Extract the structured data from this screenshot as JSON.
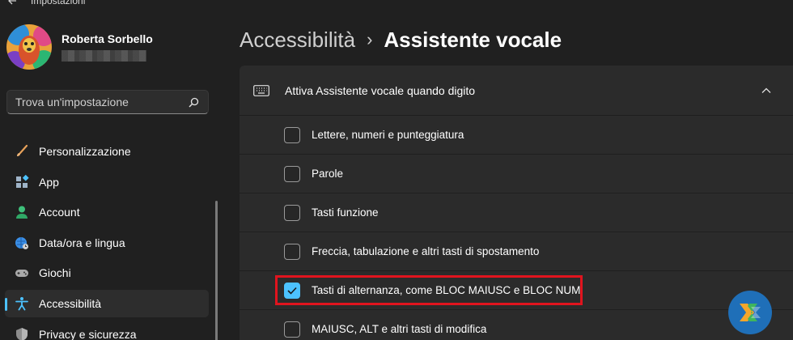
{
  "app": {
    "title": "Impostazioni"
  },
  "profile": {
    "name": "Roberta Sorbello"
  },
  "search": {
    "placeholder": "Trova un'impostazione"
  },
  "sidebar": {
    "items": [
      {
        "label": "Personalizzazione",
        "icon": "brush-icon",
        "selected": false
      },
      {
        "label": "App",
        "icon": "apps-icon",
        "selected": false
      },
      {
        "label": "Account",
        "icon": "account-icon",
        "selected": false
      },
      {
        "label": "Data/ora e lingua",
        "icon": "globe-clock-icon",
        "selected": false
      },
      {
        "label": "Giochi",
        "icon": "gamepad-icon",
        "selected": false
      },
      {
        "label": "Accessibilità",
        "icon": "accessibility-icon",
        "selected": true
      },
      {
        "label": "Privacy e sicurezza",
        "icon": "shield-icon",
        "selected": false
      }
    ]
  },
  "breadcrumb": {
    "parent": "Accessibilità",
    "separator": "›",
    "current": "Assistente vocale"
  },
  "panel": {
    "title": "Attiva Assistente vocale quando digito",
    "options": [
      {
        "label": "Lettere, numeri e punteggiatura",
        "checked": false
      },
      {
        "label": "Parole",
        "checked": false
      },
      {
        "label": "Tasti funzione",
        "checked": false
      },
      {
        "label": "Freccia, tabulazione e altri tasti di spostamento",
        "checked": false
      },
      {
        "label": "Tasti di alternanza, come BLOC MAIUSC e BLOC NUM",
        "checked": true
      },
      {
        "label": "MAIUSC, ALT e altri tasti di modifica",
        "checked": false
      }
    ]
  },
  "colors": {
    "accent": "#4cc2ff",
    "highlight": "#e0141e",
    "background": "#202020",
    "panel": "#2b2b2b"
  }
}
